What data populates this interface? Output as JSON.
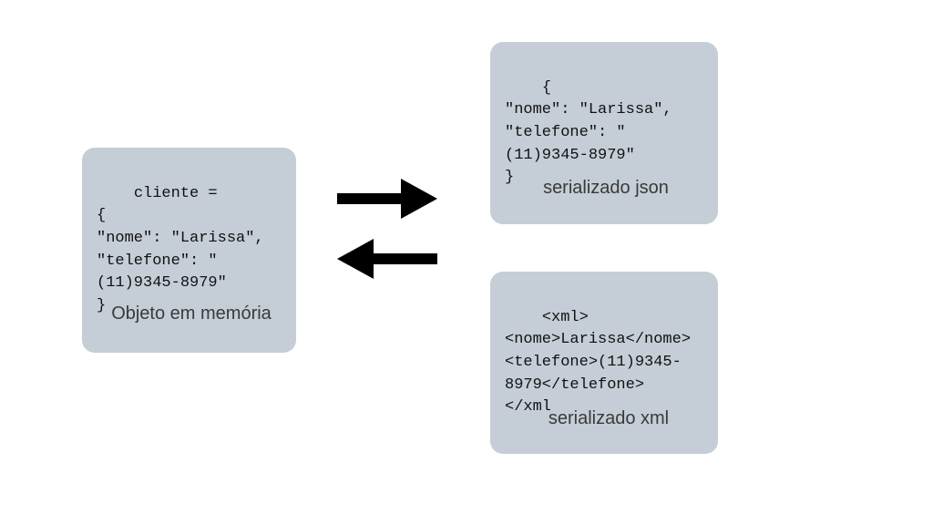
{
  "boxes": {
    "memory": {
      "code": "cliente =\n{\n\"nome\": \"Larissa\",\n\"telefone\": \"\n(11)9345-8979\"\n}",
      "caption": "Objeto em memória"
    },
    "json": {
      "code": "{\n\"nome\": \"Larissa\",\n\"telefone\": \"\n(11)9345-8979\"\n}",
      "caption": "serializado json"
    },
    "xml": {
      "code": "<xml>\n<nome>Larissa</nome>\n<telefone>(11)9345-\n8979</telefone>\n</xml",
      "caption": "serializado xml"
    }
  },
  "arrows": {
    "right": {
      "from": "memory",
      "to": "serialized"
    },
    "left": {
      "from": "serialized",
      "to": "memory"
    }
  }
}
